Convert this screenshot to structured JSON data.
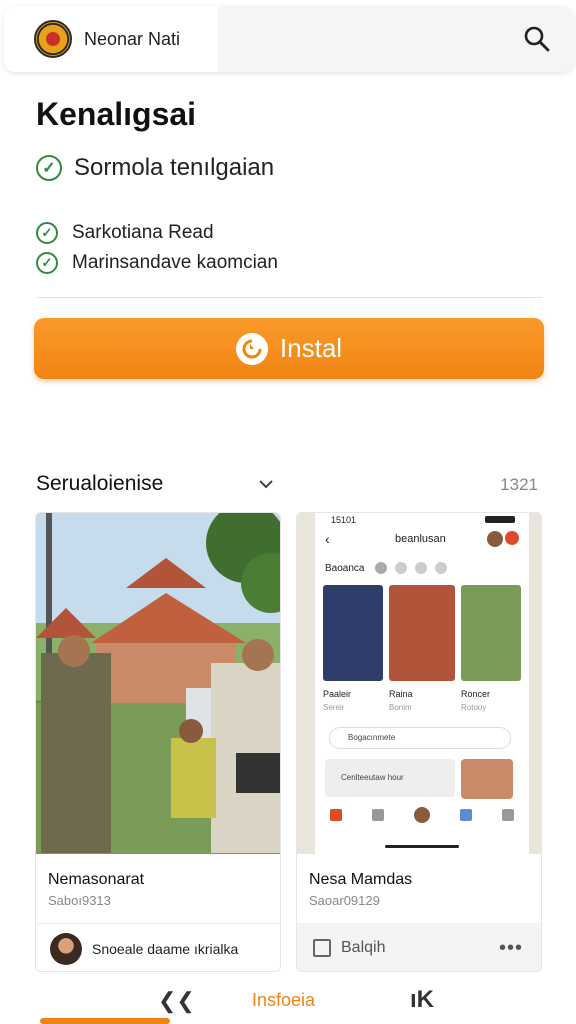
{
  "header": {
    "app_name": "Neonar Nati"
  },
  "main": {
    "title": "Kenalıgsai",
    "primary_check": "Sormola tenılgaian",
    "checks": [
      "Sarkotiana Read",
      "Marinsandave kaomcian"
    ],
    "install_label": "Instal"
  },
  "section": {
    "title": "Serualoienise",
    "count": "1321"
  },
  "cards": [
    {
      "name": "Nemasonarat",
      "sub": "Saboı9313",
      "bottom_text": "Snoeale daame ıkrialka"
    },
    {
      "name": "Nesa Mamdas",
      "sub": "Saoar09129",
      "bottom_text": "Balqih",
      "phone": {
        "time": "15101",
        "title": "beanlusan",
        "tab": "Baoanca",
        "items": [
          "Paaleir",
          "Raina",
          "Roncer"
        ],
        "item_subs": [
          "Sereir",
          "Bonim",
          "Rotooy"
        ],
        "search_text": "Bogacınmete",
        "banner_text": "Cenlteeutaw hour"
      }
    }
  ],
  "bottom_nav": {
    "back": "❮❮",
    "center": "Insfoeia",
    "right": "ıK"
  },
  "colors": {
    "accent": "#f18413",
    "check": "#2e8b3e"
  }
}
